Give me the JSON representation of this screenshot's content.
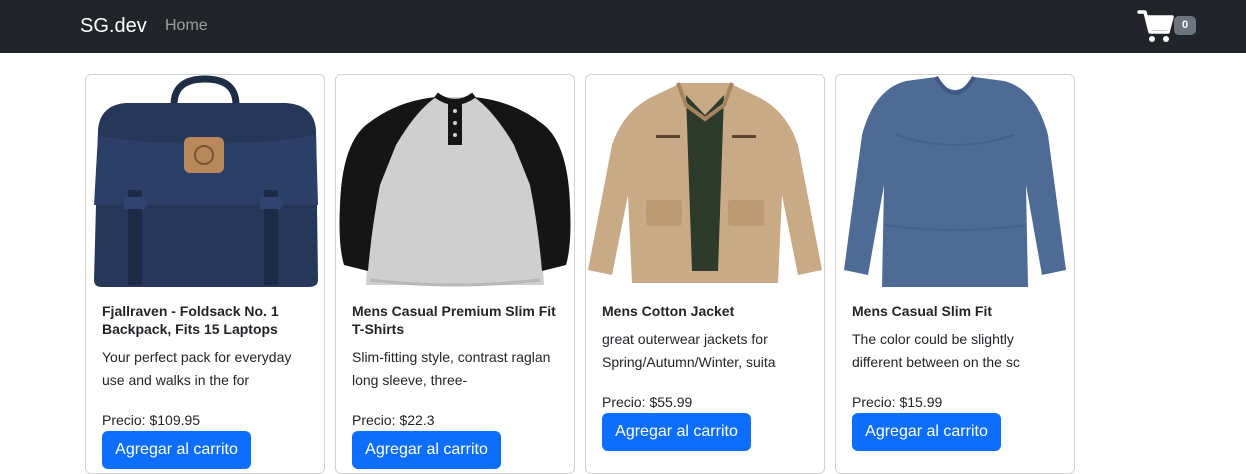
{
  "navbar": {
    "brand": "SG.dev",
    "links": [
      {
        "label": "Home"
      }
    ],
    "cart": {
      "icon": "cart-icon",
      "count": "0"
    }
  },
  "products": [
    {
      "title": "Fjallraven - Foldsack No. 1 Backpack, Fits 15 Laptops",
      "description": "Your perfect pack for everyday use and walks in the for",
      "price": "Precio: $109.95",
      "button": "Agregar al carrito",
      "image": "backpack-image"
    },
    {
      "title": "Mens Casual Premium Slim Fit T-Shirts",
      "description": "Slim-fitting style, contrast raglan long sleeve, three-",
      "price": "Precio: $22.3",
      "button": "Agregar al carrito",
      "image": "raglan-tshirt-image"
    },
    {
      "title": "Mens Cotton Jacket",
      "description": "great outerwear jackets for Spring/Autumn/Winter, suita",
      "price": "Precio: $55.99",
      "button": "Agregar al carrito",
      "image": "cotton-jacket-image"
    },
    {
      "title": "Mens Casual Slim Fit",
      "description": "The color could be slightly different between on the sc",
      "price": "Precio: $15.99",
      "button": "Agregar al carrito",
      "image": "slim-fit-shirt-image"
    }
  ]
}
